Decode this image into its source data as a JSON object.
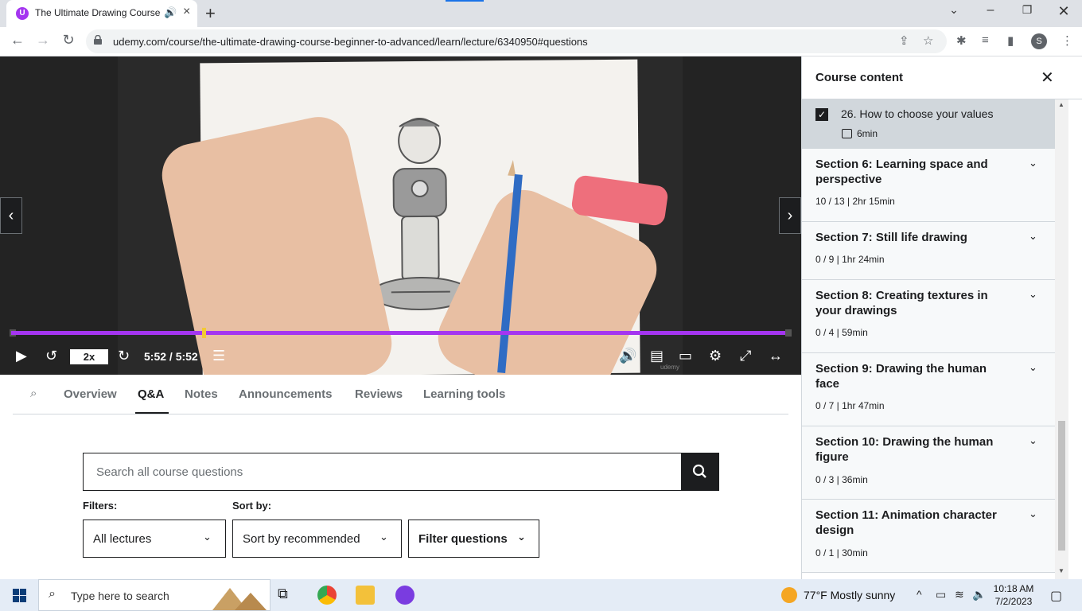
{
  "browser": {
    "tab_title": "The Ultimate Drawing Course",
    "url": "udemy.com/course/the-ultimate-drawing-course-beginner-to-advanced/learn/lecture/6340950#questions",
    "profile_initial": "S"
  },
  "player": {
    "speed": "2x",
    "timecode": "5:52 / 5:52",
    "progress": 1.0,
    "watermark": "udemy"
  },
  "tabs": [
    {
      "label": "Overview"
    },
    {
      "label": "Q&A",
      "active": true
    },
    {
      "label": "Notes"
    },
    {
      "label": "Announcements"
    },
    {
      "label": "Reviews"
    },
    {
      "label": "Learning tools"
    }
  ],
  "qa": {
    "search_placeholder": "Search all course questions",
    "filters_label": "Filters:",
    "sortby_label": "Sort by:",
    "filter_lectures": "All lectures",
    "sort_value": "Sort by recommended",
    "filter_questions": "Filter questions"
  },
  "sidebar": {
    "title": "Course content",
    "current_lecture": {
      "title": "26. How to choose your values",
      "duration": "6min",
      "completed": true
    },
    "sections": [
      {
        "title": "Section 6: Learning space and perspective",
        "meta": "10 / 13 | 2hr 15min"
      },
      {
        "title": "Section 7: Still life drawing",
        "meta": "0 / 9 | 1hr 24min"
      },
      {
        "title": "Section 8: Creating textures in your drawings",
        "meta": "0 / 4 | 59min"
      },
      {
        "title": "Section 9: Drawing the human face",
        "meta": "0 / 7 | 1hr 47min"
      },
      {
        "title": "Section 10: Drawing the human figure",
        "meta": "0 / 3 | 36min"
      },
      {
        "title": "Section 11: Animation character design",
        "meta": "0 / 1 | 30min"
      }
    ]
  },
  "taskbar": {
    "search_placeholder": "Type here to search",
    "weather": "77°F  Mostly sunny",
    "time": "10:18 AM",
    "date": "7/2/2023"
  },
  "colors": {
    "accent": "#a435f0",
    "progress_head": "#f3ca33"
  }
}
